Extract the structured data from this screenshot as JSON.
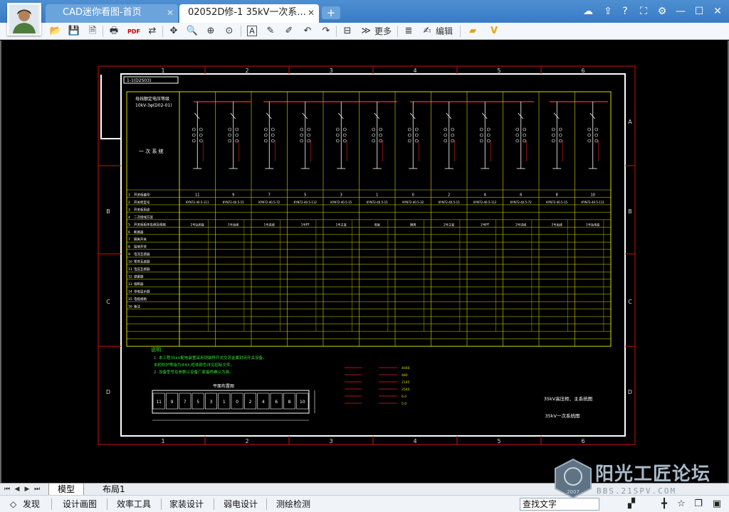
{
  "tabs": {
    "home_title": "CAD迷你看图-首页",
    "doc_title": "02052D修-1   35kV一次系..."
  },
  "window": {
    "close": "✕",
    "new_tab": "+",
    "minimize": "—",
    "maximize": "☐",
    "win_close": "✕"
  },
  "toolbar": {
    "more": "更多",
    "edit": "编辑"
  },
  "layouts": {
    "model": "模型",
    "layout1": "布局1"
  },
  "status": {
    "discover": "发现",
    "design_draw": "设计画图",
    "efficiency": "效率工具",
    "home_design": "家装设计",
    "weak_current": "弱电设计",
    "survey": "测绘检测",
    "search_placeholder": "查找文字"
  },
  "watermark": {
    "text": "阳光工匠论坛",
    "url": "BBS.21SPV.COM",
    "year": "2007"
  },
  "drawing": {
    "title_tag": "1-1(D2S03)",
    "header_line1": "母线额定电压等级",
    "header_line2": "10kV-3φ(D02-01)",
    "schematic_label": "一  次  系  统",
    "col_numbers": [
      "1",
      "2",
      "3",
      "4",
      "5",
      "6"
    ],
    "row_letters": [
      "A",
      "B",
      "C",
      "D"
    ],
    "cabinet_numbers": [
      "11",
      "9",
      "7",
      "5",
      "3",
      "1",
      "0",
      "2",
      "4",
      "6",
      "8",
      "10"
    ],
    "cabinet_types": [
      "KYN72-40.5-111",
      "KYN72-40.5-15",
      "KYN72-40.5-72",
      "KYN72-40.5-112",
      "KYN72-40.5-15",
      "KYN72-40.5-15",
      "KYN72-40.5-32",
      "KYN72-40.5-15",
      "KYN72-40.5-112",
      "KYN72-40.5-72",
      "KYN72-40.5-15",
      "KYN72-40.5-111"
    ],
    "cabinet_uses": [
      "2号站用变",
      "1号出线",
      "1号进线",
      "1号PT",
      "1号主变",
      "母联",
      "隔离",
      "2号主变",
      "2号PT",
      "2号进线",
      "2号出线",
      "1号站用变"
    ],
    "row_labels": [
      "开关柜编号",
      "开关柜型号",
      "开关柜用途",
      "二次接线方案",
      "开关柜柜体名称及规格",
      "断路器",
      "隔离开关",
      "接地开关",
      "电流互感器",
      "零序互感器",
      "电压互感器",
      "避雷器",
      "熔断器",
      "带电显示器",
      "电缆规格",
      "备注"
    ],
    "notes_title": "说明:",
    "note_1": "1. 本工程35kV配电装置采用铠装移开式交流金属封闭开关设备。",
    "note_2": "   本柜防护等级为IP4X,柜体颜色详见招标文件。",
    "note_3": "2. 设备型号及参数以设备厂家最终确认为准。",
    "plan_title": "平面布置图",
    "legend_labels": [
      "4040",
      "480",
      "2145",
      "2540",
      "6.0",
      "5.0"
    ],
    "title_block_1": "35kV高压柜、主系统图",
    "title_block_2": "35kV一次系统图"
  }
}
